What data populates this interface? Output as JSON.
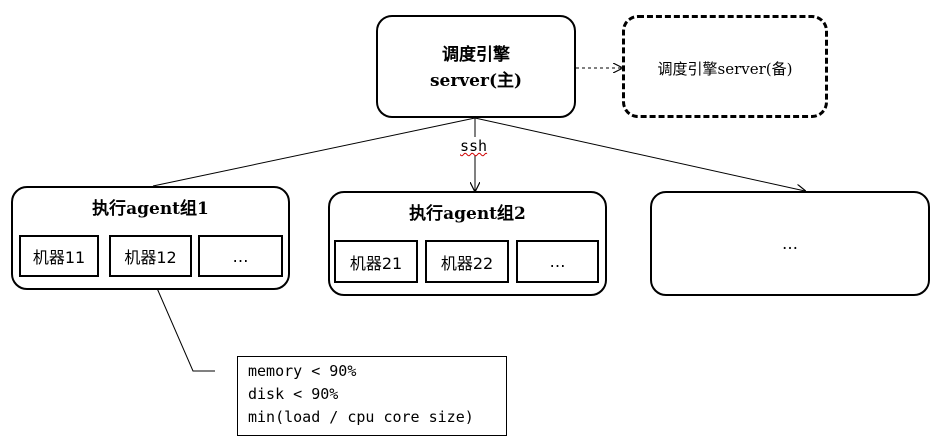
{
  "main_server": {
    "line1": "调度引擎",
    "line2": "server(主)"
  },
  "backup_server": {
    "label": "调度引擎server(备)"
  },
  "connection_label": "ssh",
  "groups": [
    {
      "title": "执行agent组1",
      "machines": [
        "机器11",
        "机器12",
        "…"
      ]
    },
    {
      "title": "执行agent组2",
      "machines": [
        "机器21",
        "机器22",
        "…"
      ]
    },
    {
      "title": "…"
    }
  ],
  "note": {
    "lines": [
      "memory < 90%",
      "disk < 90%",
      "min(load / cpu core size)"
    ]
  }
}
